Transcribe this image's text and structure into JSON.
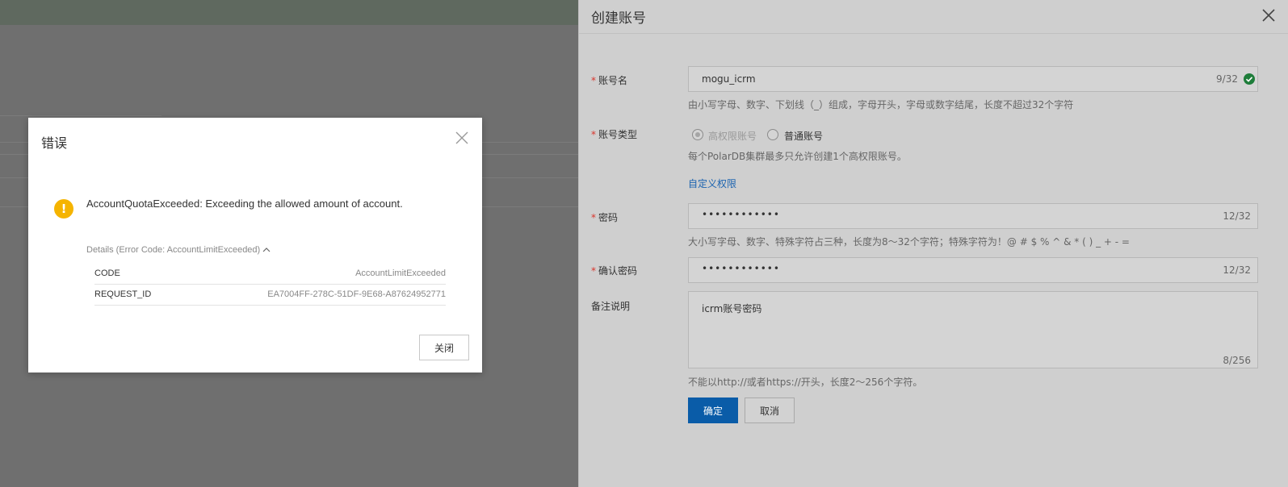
{
  "drawer": {
    "title": "创建账号",
    "account_name": {
      "label": "账号名",
      "value": "mogu_icrm",
      "counter": "9/32",
      "help": "由小写字母、数字、下划线（_）组成，字母开头，字母或数字结尾，长度不超过32个字符"
    },
    "account_type": {
      "label": "账号类型",
      "option_admin": "高权限账号",
      "option_normal": "普通账号",
      "help": "每个PolarDB集群最多只允许创建1个高权限账号。",
      "custom_link": "自定义权限"
    },
    "password": {
      "label": "密码",
      "dots": "••••••••••••",
      "counter": "12/32",
      "help": "大小写字母、数字、特殊字符占三种，长度为8～32个字符；特殊字符为！@ # $ % ^ & * ( ) _ + - ="
    },
    "confirm_password": {
      "label": "确认密码",
      "dots": "••••••••••••",
      "counter": "12/32"
    },
    "remark": {
      "label": "备注说明",
      "value": "icrm账号密码",
      "counter": "8/256",
      "help": "不能以http://或者https://开头，长度2～256个字符。"
    },
    "ok_label": "确定",
    "cancel_label": "取消"
  },
  "dialog": {
    "title": "错误",
    "message": "AccountQuotaExceeded: Exceeding the allowed amount of account.",
    "details_label": "Details (Error Code: AccountLimitExceeded)",
    "rows": [
      {
        "key": "CODE",
        "value": "AccountLimitExceeded"
      },
      {
        "key": "REQUEST_ID",
        "value": "EA7004FF-278C-51DF-9E68-A87624952771"
      }
    ],
    "close_label": "关闭"
  },
  "colors": {
    "primary": "#0a5ca8",
    "warning": "#f5b400",
    "success": "#1e7d3a",
    "required": "#d9352c"
  }
}
